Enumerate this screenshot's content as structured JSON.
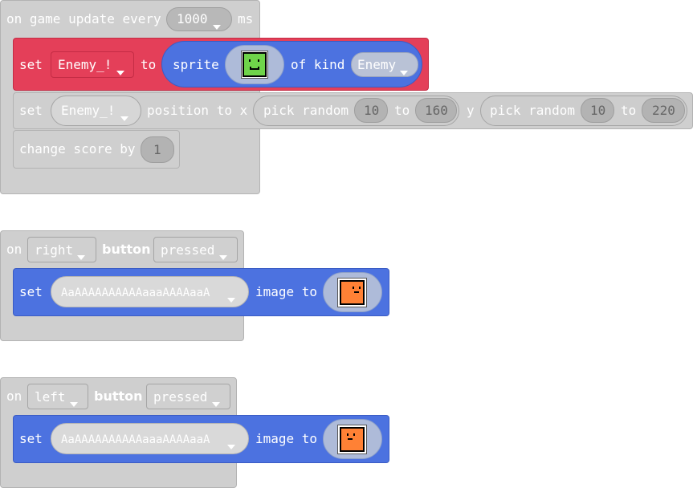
{
  "event1": {
    "on_game_update_label": "on game update every",
    "interval_value": "1000",
    "ms_label": "ms"
  },
  "set_sprite_block": {
    "set_label": "set",
    "variable": "Enemy_!",
    "to_label": "to",
    "sprite_label": "sprite",
    "of_kind_label": "of kind",
    "kind_value": "Enemy"
  },
  "position_block": {
    "set_label": "set",
    "variable": "Enemy_!",
    "position_to_x_label": "position to x",
    "pick_random_label_x": "pick random",
    "x_min": "10",
    "to_label_x": "to",
    "x_max": "160",
    "y_label": "y",
    "pick_random_label_y": "pick random",
    "y_min": "10",
    "to_label_y": "to",
    "y_max": "220"
  },
  "score_block": {
    "change_score_label": "change score by",
    "score_delta": "1"
  },
  "event_right": {
    "on_label": "on",
    "button_name": "right",
    "button_label": "button",
    "state": "pressed",
    "set_label": "set",
    "variable": "AaAAAAAAAAAAaaaAAAAaaA",
    "image_to_label": "image to"
  },
  "event_left": {
    "on_label": "on",
    "button_name": "left",
    "button_label": "button",
    "state": "pressed",
    "set_label": "set",
    "variable": "AaAAAAAAAAAAaaaAAAAaaA",
    "image_to_label": "image to"
  },
  "colors": {
    "disabled_block": "#cfcfcf",
    "sprite_red": "#e43f59",
    "sprite_blue": "#4c72e0",
    "enemy_green": "#6fd44a",
    "player_orange": "#ff8135"
  },
  "icons": [
    "dropdown-arrow-icon",
    "green-sprite-face-icon",
    "orange-sprite-face-icon"
  ]
}
